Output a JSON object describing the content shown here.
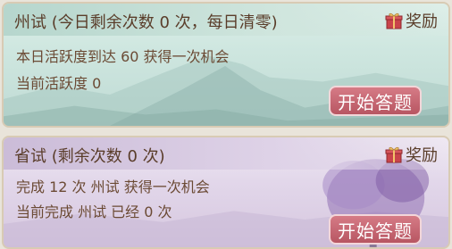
{
  "card1": {
    "title": "州试 (今日剩余次数 0 次，每日清零)",
    "reward_label": "奖励",
    "line1": "本日活跃度到达 60 获得一次机会",
    "line2": "当前活跃度 0",
    "button": "开始答题"
  },
  "card2": {
    "title": "省试 (剩余次数 0 次)",
    "reward_label": "奖励",
    "line1": "完成 12 次 州试 获得一次机会",
    "line2": "当前完成 州试 已经 0 次",
    "button": "开始答题"
  }
}
